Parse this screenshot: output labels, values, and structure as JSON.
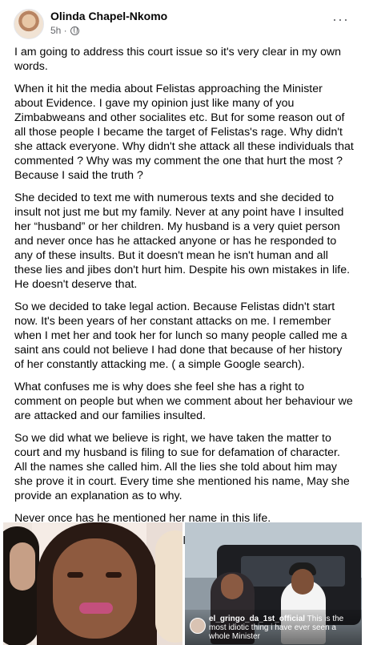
{
  "post": {
    "author": "Olinda Chapel-Nkomo",
    "time": "5h ·",
    "menu_icon": "more-dots-icon",
    "privacy_icon": "globe-icon",
    "paragraphs": [
      "I am going to address this court issue so it's very clear in my own words.",
      "When it hit the media about Felistas approaching the Minister about Evidence. I gave my opinion just like many of you Zimbabweans and other socialites etc. But for some reason out of all those people I became the target of Felistas's rage. Why didn't she attack everyone. Why didn't she attack all these individuals that commented ? Why was my comment the one that hurt the most ? Because I said the truth ?",
      "She decided to text me with numerous texts and she decided to insult not just me but my family. Never at any point have I insulted her “husband” or her children. My husband is a very quiet person and never once has he attacked anyone or has he responded to any of these insults. But it doesn't mean he isn't human and all these lies and jibes don't hurt him. Despite his own mistakes in life. He doesn't deserve that.",
      "So we decided to take legal action. Because Felistas didn't start now. It's been years of her constant attacks on me. I remember when I met her and took her for lunch so many people called me a saint ans could not believe I had done that because of her history of her constantly attacking me. ( a simple Google search).",
      "What confuses me is why does she feel she has a right to comment on people but when we comment about her behaviour we are attacked and our families insulted.",
      "So we did what we believe is right, we have taken the matter to court and my husband is filing to sue for defamation of character. All the names she called him. All the lies she told about him may she prove it in court. Every time she mentioned his name, May she provide an explanation as to why.",
      "Never once has he mentioned her name in this life.",
      "We don't report to Ministers we follow the law !"
    ]
  },
  "photos": {
    "right_caption_user": "el_gringo_da_1st_official",
    "right_caption_text": " This is the most idiotic thing i have ever seen a whole Minister"
  }
}
